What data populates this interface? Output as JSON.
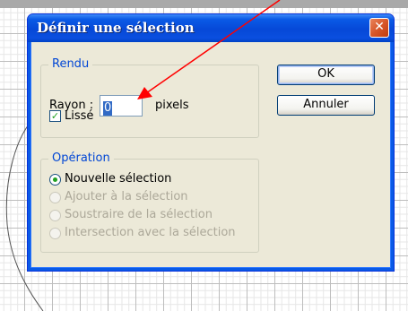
{
  "dialog": {
    "title": "Définir une sélection",
    "close_icon": "close-icon"
  },
  "rendu": {
    "legend": "Rendu",
    "radius_label": "Rayon :",
    "radius_value": "0",
    "radius_unit": "pixels",
    "smooth_label": "Lissé",
    "smooth_checked": true
  },
  "operation": {
    "legend": "Opération",
    "options": [
      {
        "label": "Nouvelle sélection",
        "selected": true,
        "enabled": true
      },
      {
        "label": "Ajouter à la sélection",
        "selected": false,
        "enabled": false
      },
      {
        "label": "Soustraire de la sélection",
        "selected": false,
        "enabled": false
      },
      {
        "label": "Intersection avec la sélection",
        "selected": false,
        "enabled": false
      }
    ]
  },
  "buttons": {
    "ok": "OK",
    "cancel": "Annuler"
  },
  "annotation": {
    "arrow_color": "#ff0000"
  }
}
